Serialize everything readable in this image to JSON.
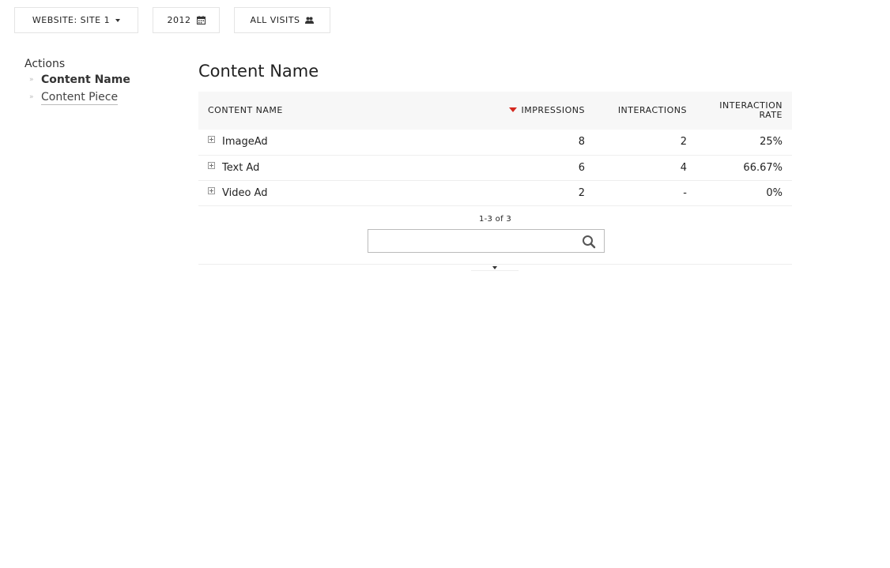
{
  "topbar": {
    "site_label": "WEBSITE: SITE 1",
    "date_label": "2012",
    "segment_label": "ALL VISITS"
  },
  "sidebar": {
    "title": "Actions",
    "items": [
      {
        "label": "Content Name",
        "active": true
      },
      {
        "label": "Content Piece",
        "active": false
      }
    ]
  },
  "report": {
    "title": "Content Name",
    "columns": {
      "label": "CONTENT NAME",
      "impressions": "IMPRESSIONS",
      "interactions": "INTERACTIONS",
      "interaction_rate": "INTERACTION RATE"
    },
    "rows": [
      {
        "label": "ImageAd",
        "impressions": "8",
        "interactions": "2",
        "interaction_rate": "25%"
      },
      {
        "label": "Text Ad",
        "impressions": "6",
        "interactions": "4",
        "interaction_rate": "66.67%"
      },
      {
        "label": "Video Ad",
        "impressions": "2",
        "interactions": "-",
        "interaction_rate": "0%"
      }
    ],
    "pagination": "1-3 of 3",
    "search": {
      "value": "",
      "placeholder": ""
    },
    "sort_color": "#d4291f"
  }
}
